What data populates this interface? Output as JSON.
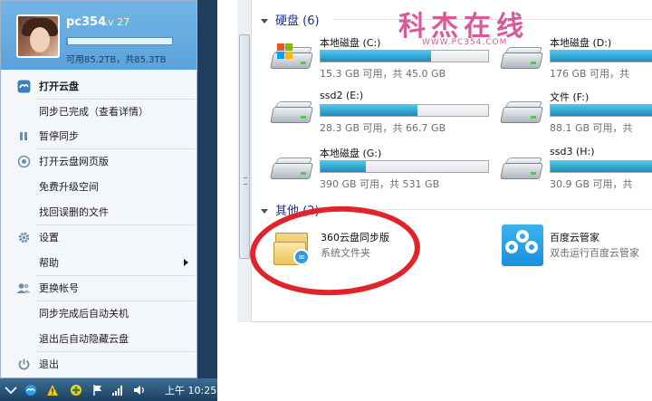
{
  "tray_menu": {
    "username": "pc354",
    "level": "Lv 27",
    "quota_text": "可用85.2TB，共85.3TB",
    "quota_used_fraction": 0.0012,
    "items": [
      {
        "label": "打开云盘",
        "icon": "cloud-disk-icon"
      },
      {
        "label": "同步已完成（查看详情）",
        "icon": ""
      },
      {
        "label": "暂停同步",
        "icon": "pause-icon"
      },
      {
        "label": "打开云盘网页版",
        "icon": "web-icon"
      },
      {
        "label": "免费升级空间",
        "icon": ""
      },
      {
        "label": "找回误删的文件",
        "icon": ""
      },
      {
        "label": "设置",
        "icon": "gear-icon"
      },
      {
        "label": "帮助",
        "icon": "",
        "submenu": true
      },
      {
        "label": "更换帐号",
        "icon": "users-icon"
      },
      {
        "label": "同步完成后自动关机",
        "icon": ""
      },
      {
        "label": "退出后自动隐藏云盘",
        "icon": ""
      },
      {
        "label": "退出",
        "icon": "power-icon"
      }
    ]
  },
  "taskbar": {
    "clock": "上午 10:25",
    "icons": [
      "language-icon",
      "cloud-tray-icon",
      "warning-icon",
      "shield-icon",
      "flag-icon",
      "network-icon",
      "volume-icon"
    ]
  },
  "explorer": {
    "groups": {
      "hard_disks": "硬盘 (6)",
      "other": "其他 (2)"
    },
    "drives": [
      {
        "name": "本地磁盘 (C:)",
        "info": "15.3 GB 可用，共 45.0 GB",
        "used_fraction": 0.66,
        "system": true
      },
      {
        "name": "本地磁盘 (D:)",
        "info": "176 GB 可用，共",
        "used_fraction": 0.7,
        "system": false
      },
      {
        "name": "ssd2 (E:)",
        "info": "28.3 GB 可用，共 66.7 GB",
        "used_fraction": 0.58,
        "system": false
      },
      {
        "name": "文件 (F:)",
        "info": "88.1 GB 可用，共",
        "used_fraction": 0.8,
        "system": false
      },
      {
        "name": "本地磁盘 (G:)",
        "info": "390 GB 可用，共 531 GB",
        "used_fraction": 0.27,
        "system": false
      },
      {
        "name": "ssd3 (H:)",
        "info": "30.9 GB 可用，共",
        "used_fraction": 0.82,
        "system": false
      }
    ],
    "others": [
      {
        "name": "360云盘同步版",
        "sub": "系统文件夹",
        "icon": "cloud-folder-icon"
      },
      {
        "name": "百度云管家",
        "sub": "双击运行百度云管家",
        "icon": "baidu-cloud-icon"
      }
    ]
  },
  "watermark": {
    "title": "科杰在线",
    "url": "WWW.PC354.COM"
  },
  "colors": {
    "accent": "#5aa2da",
    "drive_bar": "#1e8bbd",
    "annotation_circle": "#e0242a"
  }
}
